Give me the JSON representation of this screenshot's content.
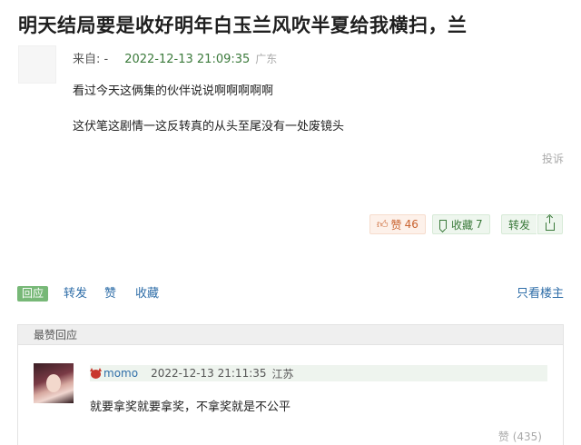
{
  "post": {
    "title": "明天结局要是收好明年白玉兰风吹半夏给我横扫，兰",
    "from_label": "来自: -",
    "time": "2022-12-13 21:09:35",
    "location": "广东",
    "line1": "看过今天这俩集的伙伴说说啊啊啊啊啊",
    "line2": "这伏笔这剧情一这反转真的从头至尾没有一处废镜头",
    "report": "投诉"
  },
  "actions": {
    "like_label": "赞",
    "like_count": "46",
    "fav_label": "收藏",
    "fav_count": "7",
    "share_label": "转发"
  },
  "toolbar": {
    "reply": "回应",
    "forward": "转发",
    "like": "赞",
    "favorite": "收藏",
    "only_op": "只看楼主"
  },
  "top_replies": {
    "header": "最赞回应",
    "items": [
      {
        "user": "momo",
        "time": "2022-12-13 21:11:35",
        "location": "江苏",
        "text": "就要拿奖就要拿奖，不拿奖就是不公平",
        "likes": "赞 (435)"
      }
    ]
  },
  "icons": {
    "like": "thumbs-up-icon",
    "favorite": "bookmark-icon",
    "share": "share-up-icon",
    "user_badge": "devil-icon"
  },
  "colors": {
    "accent_green": "#3b7a3b",
    "link_blue": "#2f6ea8",
    "like_orange": "#c9632f",
    "reply_button": "#77b877"
  }
}
